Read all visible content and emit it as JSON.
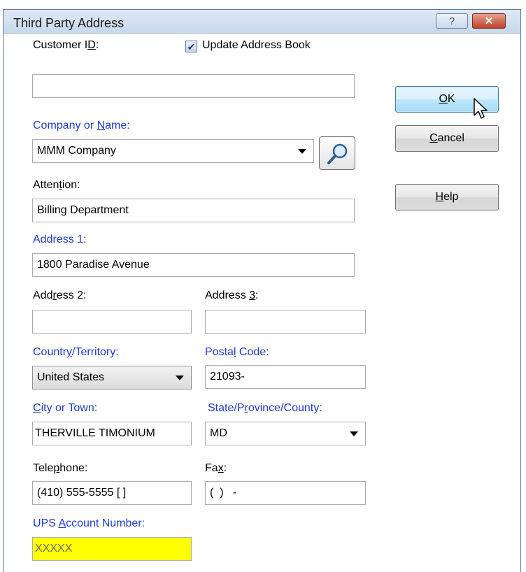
{
  "window": {
    "title": "Third Party Address",
    "help_glyph": "?",
    "close_glyph": "✕"
  },
  "form": {
    "customer_id": {
      "label": [
        "Customer I",
        "D",
        ":"
      ],
      "value": ""
    },
    "update_address_book": {
      "label": "Update Address Book",
      "checked": true,
      "check_glyph": "✔"
    },
    "company": {
      "label": [
        "Company or ",
        "N",
        "ame:"
      ],
      "value": "MMM Company"
    },
    "attention": {
      "label": [
        "Atten",
        "t",
        "ion:"
      ],
      "value": "Billing Department"
    },
    "address1": {
      "label": [
        "Address 1:"
      ],
      "value": "1800 Paradise Avenue"
    },
    "address2": {
      "label": [
        "Add",
        "r",
        "ess 2:"
      ],
      "value": ""
    },
    "address3": {
      "label": [
        "Address ",
        "3",
        ":"
      ],
      "value": ""
    },
    "country": {
      "label": [
        "Countr",
        "y",
        "/Territory:"
      ],
      "value": "United States"
    },
    "postal": {
      "label": [
        "Posta",
        "l",
        " Code:"
      ],
      "value": "21093-"
    },
    "city": {
      "label": [
        "",
        "C",
        "ity or Town:"
      ],
      "value": "THERVILLE TIMONIUM"
    },
    "state": {
      "label": [
        "State/P",
        "r",
        "ovince/County:"
      ],
      "value": "MD"
    },
    "telephone": {
      "label": [
        "Tele",
        "p",
        "hone:"
      ],
      "value": "(410) 555-5555 [   ]"
    },
    "fax": {
      "label": [
        "Fa",
        "x",
        ":"
      ],
      "value": "(  )   -"
    },
    "ups_account": {
      "label": [
        "UPS ",
        "A",
        "ccount Number:"
      ],
      "value": "XXXXX"
    }
  },
  "buttons": {
    "ok": [
      "",
      "O",
      "K"
    ],
    "cancel": [
      "",
      "C",
      "ancel"
    ],
    "help": [
      "",
      "H",
      "elp"
    ]
  },
  "colors": {
    "required_label": "#1f3ad6",
    "highlight_field": "#ffff00",
    "default_button": "#bee6fd"
  },
  "icons": [
    "help-icon",
    "close-icon",
    "search-icon",
    "dropdown-arrow-icon",
    "checkmark-icon",
    "mouse-cursor-icon"
  ]
}
